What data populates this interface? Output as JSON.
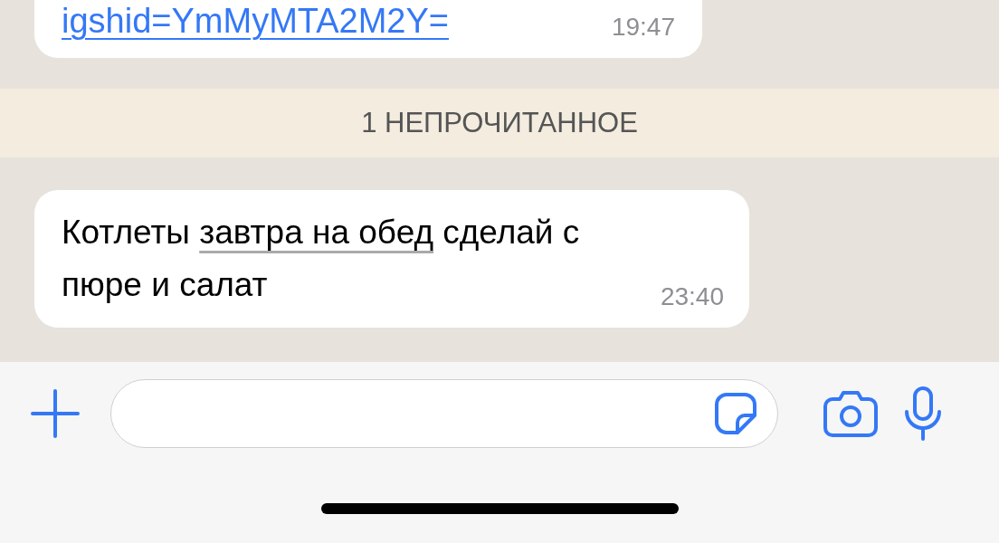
{
  "messages": [
    {
      "kind": "link",
      "text": "igshid=YmMyMTA2M2Y=",
      "time": "19:47"
    },
    {
      "kind": "unread",
      "text": "1 НЕПРОЧИТАННОЕ"
    },
    {
      "kind": "text",
      "parts": [
        {
          "kind": "plain",
          "text": "Котлеты "
        },
        {
          "kind": "date",
          "text": "завтра на обед"
        },
        {
          "kind": "plain",
          "text": " сделай с пюре и салат"
        }
      ],
      "time": "23:40"
    }
  ]
}
